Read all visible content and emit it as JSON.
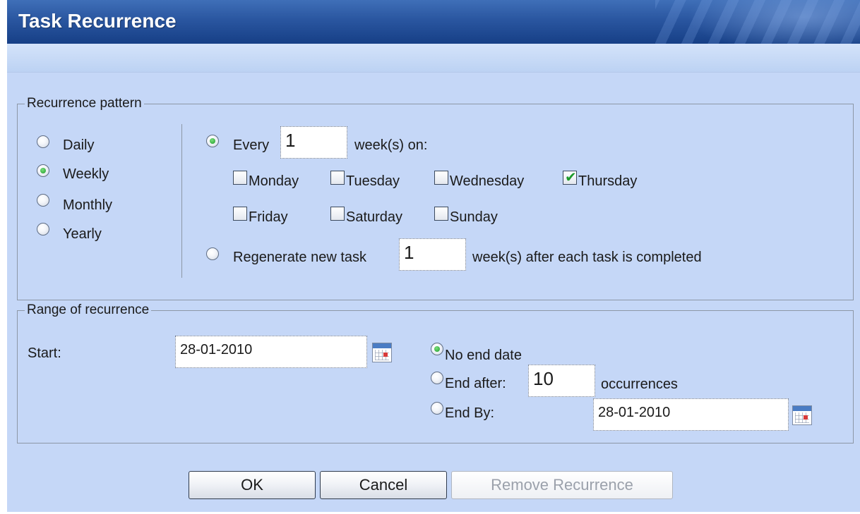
{
  "title": "Task Recurrence",
  "pattern": {
    "legend": "Recurrence pattern",
    "frequencies": [
      "Daily",
      "Weekly",
      "Monthly",
      "Yearly"
    ],
    "selected_frequency": "Weekly",
    "every_label": "Every",
    "every_value": "1",
    "weeks_on_label": "week(s) on:",
    "days": {
      "monday": "Monday",
      "tuesday": "Tuesday",
      "wednesday": "Wednesday",
      "thursday": "Thursday",
      "friday": "Friday",
      "saturday": "Saturday",
      "sunday": "Sunday"
    },
    "checked_days": [
      "Thursday"
    ],
    "regenerate_label": "Regenerate new task",
    "regenerate_value": "1",
    "regenerate_suffix": "week(s) after each task is completed"
  },
  "range": {
    "legend": "Range of recurrence",
    "start_label": "Start:",
    "start_value": "28-01-2010",
    "no_end_label": "No end date",
    "end_after_label": "End after:",
    "end_after_value": "10",
    "occurrences_label": "occurrences",
    "end_by_label": "End By:",
    "end_by_value": "28-01-2010",
    "selected_end": "No end date"
  },
  "buttons": {
    "ok": "OK",
    "cancel": "Cancel",
    "remove": "Remove Recurrence"
  },
  "colors": {
    "title_bar": "#2a56a0",
    "body_bg": "#c5d7f7",
    "radio_dot": "#1d9a2b"
  },
  "icons": {
    "calendar": "calendar-icon"
  }
}
